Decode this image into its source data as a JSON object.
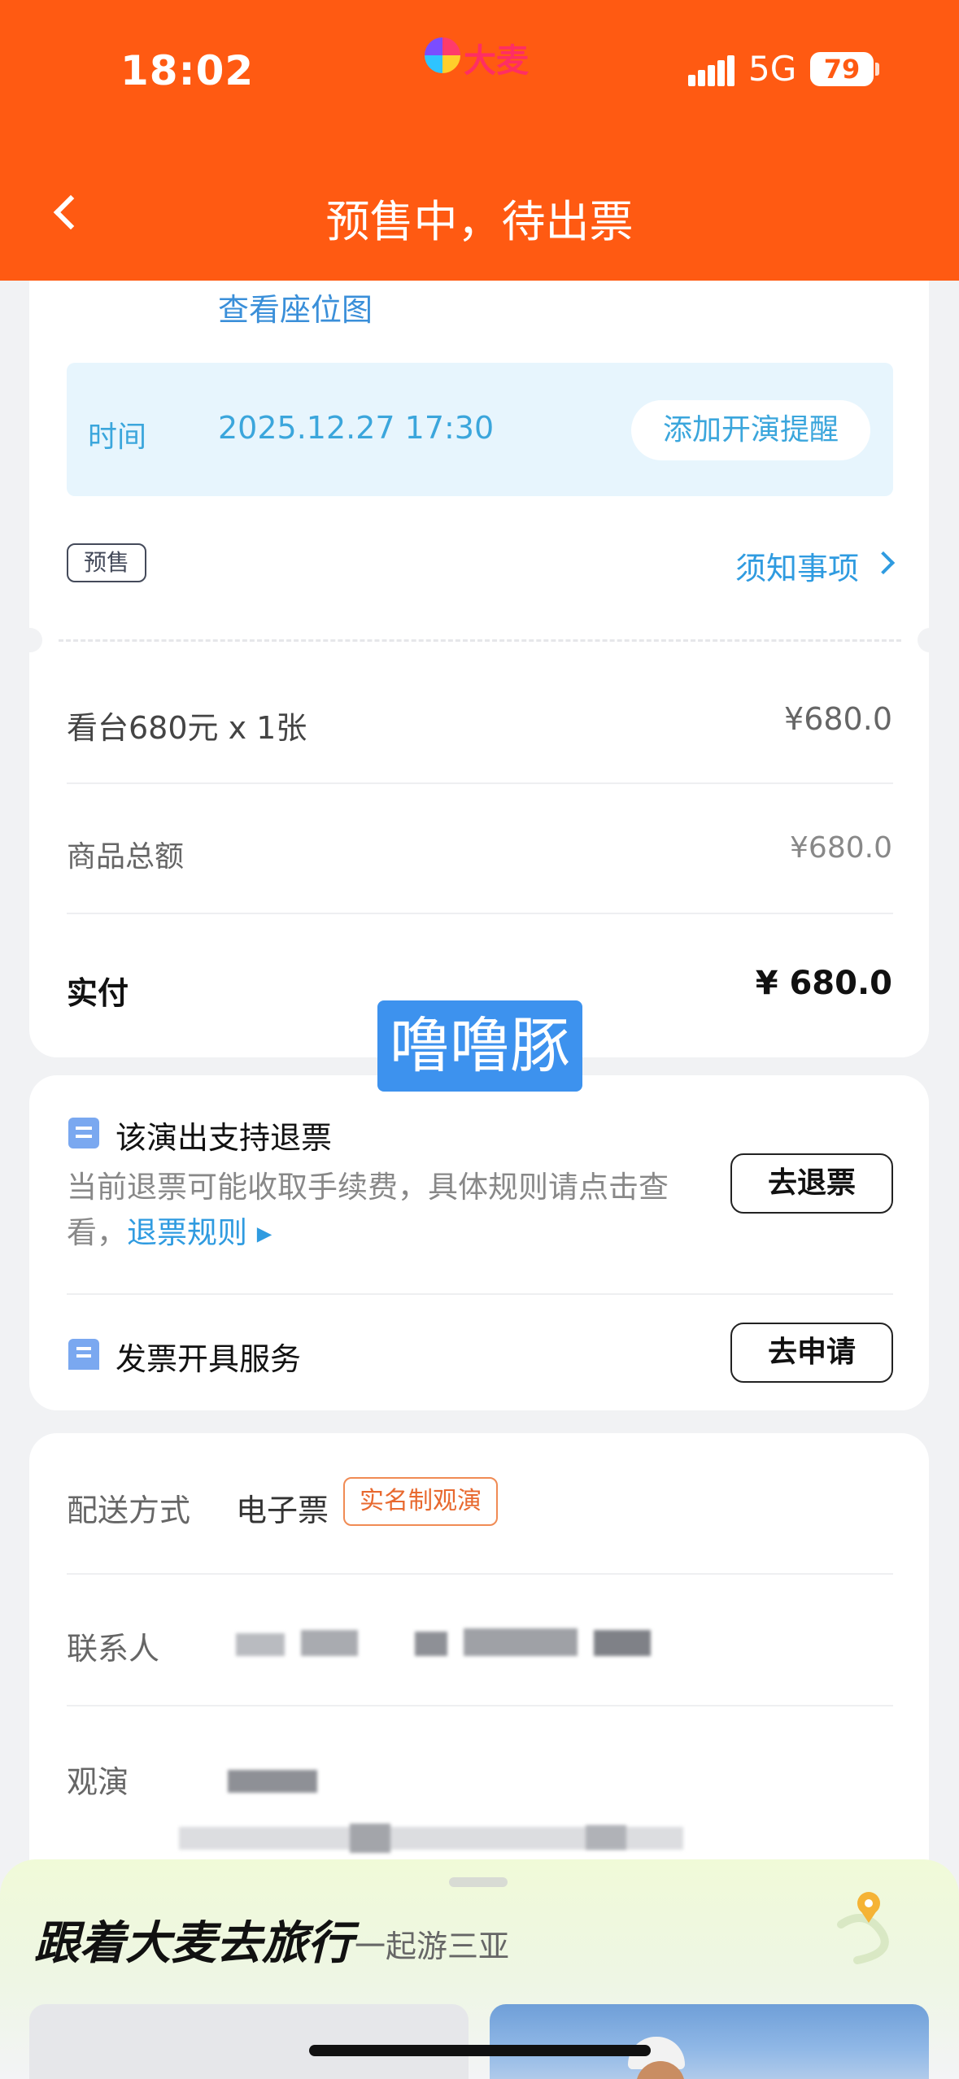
{
  "status_bar": {
    "time": "18:02",
    "brand_logo_text": "大麦",
    "network": "5G",
    "battery": "79"
  },
  "nav": {
    "title": "预售中，待出票"
  },
  "event": {
    "seat_map_link": "查看座位图",
    "time_label": "时间",
    "time_value": "2025.12.27 17:30",
    "remind_button": "添加开演提醒",
    "presale_badge": "预售",
    "notice_link": "须知事项"
  },
  "price": {
    "rows": [
      {
        "label": "看台680元 x 1张",
        "value": "¥680.0"
      },
      {
        "label": "商品总额",
        "value": "¥680.0"
      }
    ],
    "paid_label": "实付",
    "paid_value": "¥ 680.0"
  },
  "watermark": "噜噜豚",
  "refund": {
    "title": "该演出支持退票",
    "desc": "当前退票可能收取手续费，具体规则请点击查看，",
    "rules_link": "退票规则 ▸",
    "button": "去退票"
  },
  "invoice": {
    "title": "发票开具服务",
    "button": "去申请"
  },
  "delivery": {
    "method_label": "配送方式",
    "method_value": "电子票",
    "realname_tag": "实名制观演",
    "contact_label": "联系人",
    "viewer_label": "观演"
  },
  "promo": {
    "title": "跟着大麦去旅行",
    "subtitle": "一起游三亚"
  },
  "colors": {
    "header": "#ff5a12",
    "link": "#2f9be0",
    "time_text": "#3ba6dc",
    "watermark_bg": "#3d92ee",
    "tag_orange": "#e8692f"
  }
}
